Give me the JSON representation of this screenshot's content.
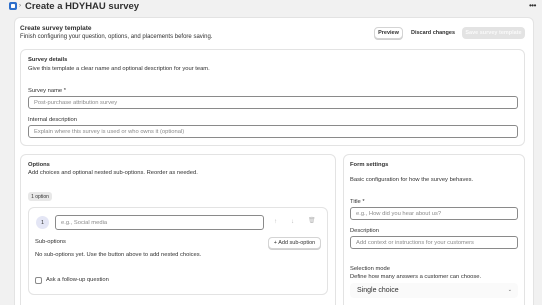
{
  "header": {
    "title": "Create a HDYHAU survey"
  },
  "template_card": {
    "title": "Create survey template",
    "subtitle": "Finish configuring your question, options, and placements before saving.",
    "preview_label": "Preview",
    "discard_label": "Discard changes",
    "save_label": "Save survey template"
  },
  "survey_details": {
    "title": "Survey details",
    "subtitle": "Give this template a clear name and optional description for your team.",
    "name_label": "Survey name *",
    "name_placeholder": "Post-purchase attribution survey",
    "description_label": "Internal description",
    "description_placeholder": "Explain where this survey is used or who owns it (optional)"
  },
  "options": {
    "title": "Options",
    "subtitle": "Add choices and optional nested sub-options. Reorder as needed.",
    "count_badge": "1 option",
    "items": [
      {
        "index": "1",
        "placeholder": "e.g., Social media",
        "sub_options_label": "Sub-options",
        "add_sub_option_label": "+ Add sub-option",
        "empty_text": "No sub-options yet. Use the button above to add nested choices.",
        "follow_up_label": "Ask a follow-up question"
      }
    ]
  },
  "form_settings": {
    "title": "Form settings",
    "subtitle": "Basic configuration for how the survey behaves.",
    "title_label": "Title *",
    "title_placeholder": "e.g., How did you hear about us?",
    "description_label": "Description",
    "description_placeholder": "Add context or instructions for your customers",
    "selection_mode_label": "Selection mode",
    "selection_mode_help": "Define how many answers a customer can choose.",
    "selection_mode_value": "Single choice"
  }
}
